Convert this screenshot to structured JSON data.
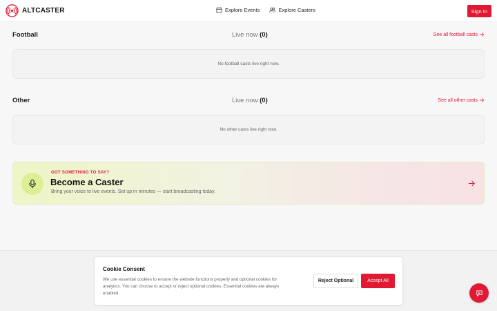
{
  "brand": {
    "name": "ALTCASTER",
    "accent": "#e11932"
  },
  "nav": {
    "items": [
      {
        "label": "Explore Events",
        "icon": "calendar-icon"
      },
      {
        "label": "Explore Casters",
        "icon": "users-icon"
      }
    ],
    "signin_label": "Sign In"
  },
  "sections": [
    {
      "title": "Football",
      "live_label": "Live now",
      "live_count": "(0)",
      "see_all": "See all football casts",
      "empty_text": "No football casts live right now."
    },
    {
      "title": "Other",
      "live_label": "Live now",
      "live_count": "(0)",
      "see_all": "See all other casts",
      "empty_text": "No other casts live right now."
    }
  ],
  "promo": {
    "kicker": "GOT SOMETHING TO SAY?",
    "title": "Become a Caster",
    "description": "Bring your voice to live events. Set up in minutes — start broadcasting today.",
    "icon": "microphone-icon"
  },
  "cookie": {
    "title": "Cookie Consent",
    "text": "We use essential cookies to ensure the website functions properly and optional cookies for analytics. You can choose to accept or reject optional cookies. Essential cookies are always enabled.",
    "reject_label": "Reject Optional",
    "accept_label": "Accept All"
  },
  "chat": {
    "icon": "chat-icon"
  }
}
